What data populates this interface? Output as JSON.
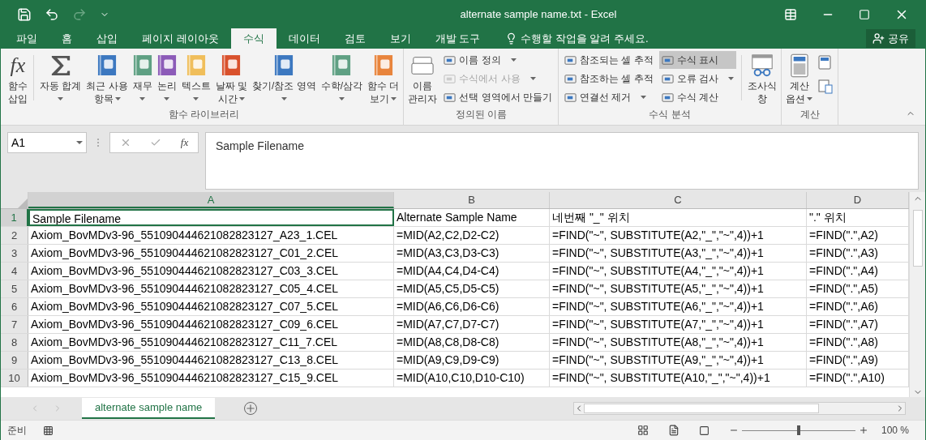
{
  "window": {
    "title": "alternate sample name.txt - Excel"
  },
  "tabs": [
    {
      "label": "파일",
      "selected": false
    },
    {
      "label": "홈",
      "selected": false
    },
    {
      "label": "삽입",
      "selected": false
    },
    {
      "label": "페이지 레이아웃",
      "selected": false
    },
    {
      "label": "수식",
      "selected": true
    },
    {
      "label": "데이터",
      "selected": false
    },
    {
      "label": "검토",
      "selected": false
    },
    {
      "label": "보기",
      "selected": false
    },
    {
      "label": "개발 도구",
      "selected": false
    }
  ],
  "tell_me": {
    "placeholder": "수행할 작업을 알려 주세요."
  },
  "share_button": "공유",
  "ribbon": [
    {
      "label": "함수 라이브러리",
      "items": [
        {
          "kind": "insert_function",
          "glyph": "fx",
          "lines": [
            "함수",
            "삽입"
          ],
          "dropdown": false
        },
        {
          "kind": "separator"
        },
        {
          "kind": "autosum",
          "lines": [
            "자동 합계"
          ],
          "dropdown": true
        },
        {
          "kind": "category",
          "lines": [
            "최근 사용",
            "항목"
          ],
          "dropdown": true
        },
        {
          "kind": "category",
          "lines": [
            "재무"
          ],
          "dropdown": true
        },
        {
          "kind": "category",
          "lines": [
            "논리"
          ],
          "dropdown": true
        },
        {
          "kind": "category",
          "lines": [
            "텍스트"
          ],
          "dropdown": true
        },
        {
          "kind": "category",
          "lines": [
            "날짜 및",
            "시간"
          ],
          "dropdown": true
        },
        {
          "kind": "category",
          "lines": [
            "찾기/참조 영역"
          ],
          "dropdown": true
        },
        {
          "kind": "category",
          "lines": [
            "수학/삼각"
          ],
          "dropdown": true
        },
        {
          "kind": "category",
          "lines": [
            "함수 더",
            "보기"
          ],
          "dropdown": true
        }
      ]
    },
    {
      "label": "정의된 이름",
      "items": [
        {
          "kind": "name_manager",
          "lines": [
            "이름",
            "관리자"
          ],
          "dropdown": false
        },
        {
          "kind": "stack",
          "buttons": [
            {
              "label": "이름 정의",
              "dropdown": true,
              "disabled": false,
              "selected": false
            },
            {
              "label": "수식에서 사용",
              "dropdown": true,
              "disabled": true,
              "selected": false
            },
            {
              "label": "선택 영역에서 만들기",
              "dropdown": false,
              "disabled": false,
              "selected": false
            }
          ]
        }
      ]
    },
    {
      "label": "수식 분석",
      "items": [
        {
          "kind": "stack",
          "buttons": [
            {
              "label": "참조되는 셀 추적",
              "dropdown": false,
              "disabled": false,
              "selected": false
            },
            {
              "label": "참조하는 셀 추적",
              "dropdown": false,
              "disabled": false,
              "selected": false
            },
            {
              "label": "연결선 제거",
              "dropdown": true,
              "disabled": false,
              "selected": false
            }
          ]
        },
        {
          "kind": "stack",
          "buttons": [
            {
              "label": "수식 표시",
              "dropdown": false,
              "disabled": false,
              "selected": true
            },
            {
              "label": "오류 검사",
              "dropdown": true,
              "disabled": false,
              "selected": false
            },
            {
              "label": "수식 계산",
              "dropdown": false,
              "disabled": false,
              "selected": false
            }
          ]
        },
        {
          "kind": "separator"
        },
        {
          "kind": "watch_window",
          "lines": [
            "조사식",
            "창"
          ],
          "dropdown": false
        }
      ]
    },
    {
      "label": "계산",
      "items": [
        {
          "kind": "calc_options",
          "lines": [
            "계산",
            "옵션"
          ],
          "dropdown": true
        },
        {
          "kind": "icons"
        }
      ]
    }
  ],
  "name_box": "A1",
  "fx_button": "fx",
  "formula": "Sample Filename",
  "columns": [
    {
      "label": "A",
      "selected": true
    },
    {
      "label": "B",
      "selected": false
    },
    {
      "label": "C",
      "selected": false
    },
    {
      "label": "D",
      "selected": false
    }
  ],
  "rows": [
    {
      "number": "1",
      "selected": true,
      "cells": [
        "Sample Filename",
        "Alternate Sample Name",
        "네번째 \"_\" 위치",
        "\".\" 위치"
      ]
    },
    {
      "number": "2",
      "selected": false,
      "cells": [
        "Axiom_BovMDv3-96_551090444621082823127_A23_1.CEL",
        "=MID(A2,C2,D2-C2)",
        "=FIND(\"~\", SUBSTITUTE(A2,\"_\",\"~\",4))+1",
        "=FIND(\".\",A2)"
      ]
    },
    {
      "number": "3",
      "selected": false,
      "cells": [
        "Axiom_BovMDv3-96_551090444621082823127_C01_2.CEL",
        "=MID(A3,C3,D3-C3)",
        "=FIND(\"~\", SUBSTITUTE(A3,\"_\",\"~\",4))+1",
        "=FIND(\".\",A3)"
      ]
    },
    {
      "number": "4",
      "selected": false,
      "cells": [
        "Axiom_BovMDv3-96_551090444621082823127_C03_3.CEL",
        "=MID(A4,C4,D4-C4)",
        "=FIND(\"~\", SUBSTITUTE(A4,\"_\",\"~\",4))+1",
        "=FIND(\".\",A4)"
      ]
    },
    {
      "number": "5",
      "selected": false,
      "cells": [
        "Axiom_BovMDv3-96_551090444621082823127_C05_4.CEL",
        "=MID(A5,C5,D5-C5)",
        "=FIND(\"~\", SUBSTITUTE(A5,\"_\",\"~\",4))+1",
        "=FIND(\".\",A5)"
      ]
    },
    {
      "number": "6",
      "selected": false,
      "cells": [
        "Axiom_BovMDv3-96_551090444621082823127_C07_5.CEL",
        "=MID(A6,C6,D6-C6)",
        "=FIND(\"~\", SUBSTITUTE(A6,\"_\",\"~\",4))+1",
        "=FIND(\".\",A6)"
      ]
    },
    {
      "number": "7",
      "selected": false,
      "cells": [
        "Axiom_BovMDv3-96_551090444621082823127_C09_6.CEL",
        "=MID(A7,C7,D7-C7)",
        "=FIND(\"~\", SUBSTITUTE(A7,\"_\",\"~\",4))+1",
        "=FIND(\".\",A7)"
      ]
    },
    {
      "number": "8",
      "selected": false,
      "cells": [
        "Axiom_BovMDv3-96_551090444621082823127_C11_7.CEL",
        "=MID(A8,C8,D8-C8)",
        "=FIND(\"~\", SUBSTITUTE(A8,\"_\",\"~\",4))+1",
        "=FIND(\".\",A8)"
      ]
    },
    {
      "number": "9",
      "selected": false,
      "cells": [
        "Axiom_BovMDv3-96_551090444621082823127_C13_8.CEL",
        "=MID(A9,C9,D9-C9)",
        "=FIND(\"~\", SUBSTITUTE(A9,\"_\",\"~\",4))+1",
        "=FIND(\".\",A9)"
      ]
    },
    {
      "number": "10",
      "selected": false,
      "cells": [
        "Axiom_BovMDv3-96_551090444621082823127_C15_9.CEL",
        "=MID(A10,C10,D10-C10)",
        "=FIND(\"~\", SUBSTITUTE(A10,\"_\",\"~\",4))+1",
        "=FIND(\".\",A10)"
      ]
    }
  ],
  "sheets": [
    {
      "label": "alternate sample name",
      "selected": true
    }
  ],
  "status_bar": {
    "text": "준비",
    "zoom": "100 %",
    "level": 0.5
  }
}
